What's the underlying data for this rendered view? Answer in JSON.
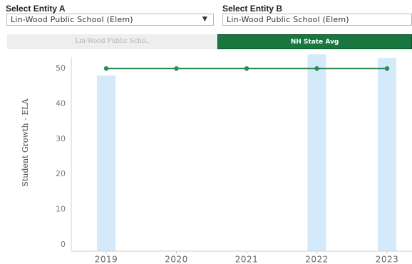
{
  "filters": {
    "entity_a": {
      "label": "Select Entity A",
      "value": "Lin-Wood Public School (Elem)"
    },
    "entity_b": {
      "label": "Select Entity B",
      "value": "Lin-Wood Public School (Elem)"
    }
  },
  "toggles": {
    "a_label": "Lin-Wood Public Scho..",
    "b_label": "NH State Avg",
    "active": "b"
  },
  "colors": {
    "bar": "#d4e9fa",
    "line": "#2e8b57",
    "toggle_active": "#17773f",
    "gridline": "#e3e3e3"
  },
  "icons": {
    "dropdown": "chevron-down-icon"
  },
  "chart_data": {
    "type": "bar",
    "title": "",
    "xlabel": "",
    "ylabel": "Student Growth - ELA",
    "categories": [
      "2019",
      "2020",
      "2021",
      "2022",
      "2023"
    ],
    "series": [
      {
        "type": "bar",
        "values": [
          48,
          null,
          null,
          54,
          53
        ]
      },
      {
        "type": "line",
        "values": [
          50,
          50,
          50,
          50,
          50
        ]
      }
    ],
    "ylim": [
      0,
      55
    ],
    "yticks": [
      0,
      10,
      20,
      30,
      40,
      50
    ],
    "grid": false
  }
}
